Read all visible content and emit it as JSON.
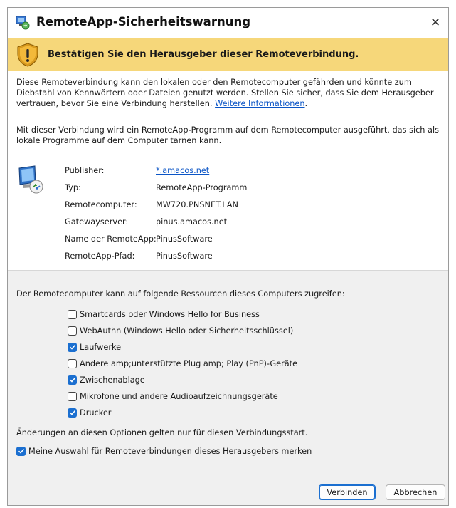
{
  "window": {
    "title": "RemoteApp-Sicherheitswarnung",
    "close_glyph": "✕"
  },
  "banner": {
    "icon": "warning-shield-icon",
    "text": "Bestätigen Sie den Herausgeber dieser Remoteverbindung."
  },
  "description": {
    "line1": "Diese Remoteverbindung kann den lokalen oder den Remotecomputer gefährden und könnte zum",
    "line2": "Diebstahl von Kennwörtern oder Dateien genutzt werden. Stellen Sie sicher, dass Sie dem Herausgeber",
    "line3_prefix": "vertrauen, bevor Sie eine Verbindung herstellen.",
    "link_text": "Weitere Informationen",
    "line3_suffix": ".",
    "para2_line1": "Mit dieser Verbindung wird ein RemoteApp-Programm auf dem Remotecomputer ausgeführt, das sich als",
    "para2_line2": "lokale Programme auf dem Computer tarnen kann."
  },
  "details": [
    {
      "label": "Publisher:",
      "value": "*.amacos.net",
      "is_link": true
    },
    {
      "label": "Typ:",
      "value": "RemoteApp-Programm",
      "is_link": false
    },
    {
      "label": "Remotecomputer:",
      "value": "MW720.PNSNET.LAN",
      "is_link": false
    },
    {
      "label": "Gatewayserver:",
      "value": "pinus.amacos.net",
      "is_link": false
    },
    {
      "label": "Name der RemoteApp:",
      "value": "PinusSoftware",
      "is_link": false
    },
    {
      "label": "RemoteApp-Pfad:",
      "value": "PinusSoftware",
      "is_link": false
    }
  ],
  "resources": {
    "heading": "Der Remotecomputer kann auf folgende Ressourcen dieses Computers zugreifen:",
    "items": [
      {
        "label": "Smartcards oder Windows Hello for Business",
        "checked": false
      },
      {
        "label": "WebAuthn (Windows Hello oder Sicherheitsschlüssel)",
        "checked": false
      },
      {
        "label": "Laufwerke",
        "checked": true
      },
      {
        "label": "Andere amp;unterstützte Plug amp; Play (PnP)-Geräte",
        "checked": false
      },
      {
        "label": "Zwischenablage",
        "checked": true
      },
      {
        "label": "Mikrofone und andere Audioaufzeichnungsgeräte",
        "checked": false
      },
      {
        "label": "Drucker",
        "checked": true
      }
    ],
    "note": "Änderungen an diesen Optionen gelten nur für diesen Verbindungsstart.",
    "remember": {
      "label": "Meine Auswahl für Remoteverbindungen dieses Herausgebers merken",
      "checked": true
    }
  },
  "buttons": {
    "connect": "Verbinden",
    "cancel": "Abbrechen"
  },
  "colors": {
    "banner_bg": "#f6d77a",
    "link": "#0b55c6",
    "checkbox_checked": "#1b6fd0"
  }
}
